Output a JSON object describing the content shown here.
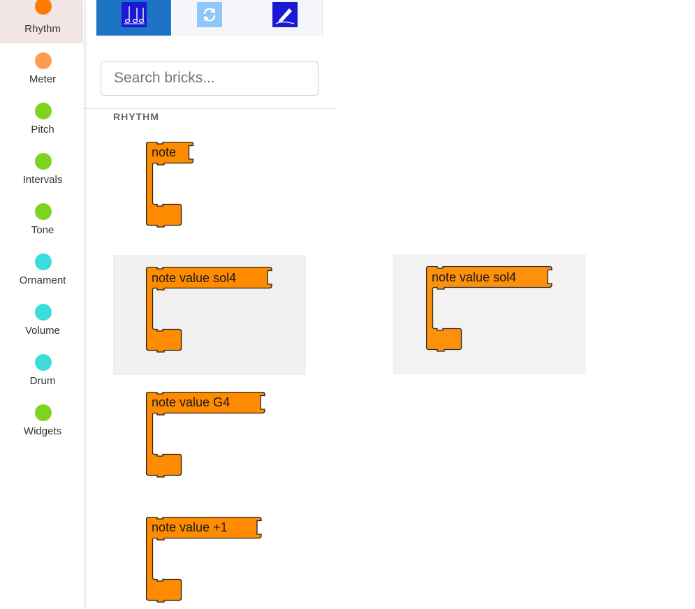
{
  "sidebar": {
    "categories": [
      {
        "label": "Rhythm",
        "color": "#ff7a00",
        "active": true
      },
      {
        "label": "Meter",
        "color": "#ff9a52",
        "active": false
      },
      {
        "label": "Pitch",
        "color": "#7ed321",
        "active": false
      },
      {
        "label": "Intervals",
        "color": "#7ed321",
        "active": false
      },
      {
        "label": "Tone",
        "color": "#7ed321",
        "active": false
      },
      {
        "label": "Ornament",
        "color": "#3bdcdc",
        "active": false
      },
      {
        "label": "Volume",
        "color": "#3bdcdc",
        "active": false
      },
      {
        "label": "Drum",
        "color": "#3bdcdc",
        "active": false
      },
      {
        "label": "Widgets",
        "color": "#7ed321",
        "active": false
      }
    ]
  },
  "tabs": [
    {
      "icon": "music-notes-icon",
      "active": true
    },
    {
      "icon": "refresh-icon",
      "active": false
    },
    {
      "icon": "pen-icon",
      "active": false
    }
  ],
  "search": {
    "placeholder": "Search bricks..."
  },
  "section_title": "RHYTHM",
  "bricks": [
    {
      "label": "note"
    },
    {
      "label": "note value sol4"
    },
    {
      "label": "note value G4"
    },
    {
      "label": "note value +1"
    }
  ],
  "drag_preview": {
    "label": "note value sol4"
  },
  "colors": {
    "brick_fill": "#ff8c00",
    "brick_stroke": "#1f1f1f",
    "tab_active": "#1e74c4",
    "highlight": "#f0f0f0"
  }
}
